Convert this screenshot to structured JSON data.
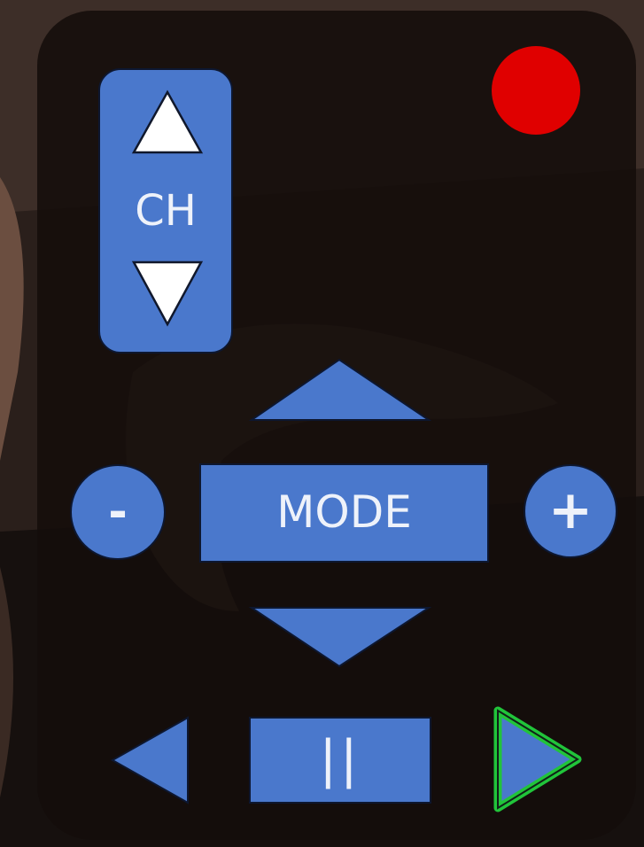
{
  "remote": {
    "channel_label": "CH",
    "mode_label": "MODE",
    "minus_label": "-",
    "plus_label": "+",
    "pause_label": "||"
  },
  "icons": {
    "record": "record-icon",
    "channel_up": "triangle-up-icon",
    "channel_down": "triangle-down-icon",
    "mode_up": "triangle-up-icon",
    "mode_down": "triangle-down-icon",
    "previous": "triangle-left-icon",
    "next": "triangle-right-icon"
  },
  "colors": {
    "button_blue": "#4a78cc",
    "record_red": "#e00000",
    "next_highlight": "#21c43a",
    "panel": "#140d0b"
  }
}
